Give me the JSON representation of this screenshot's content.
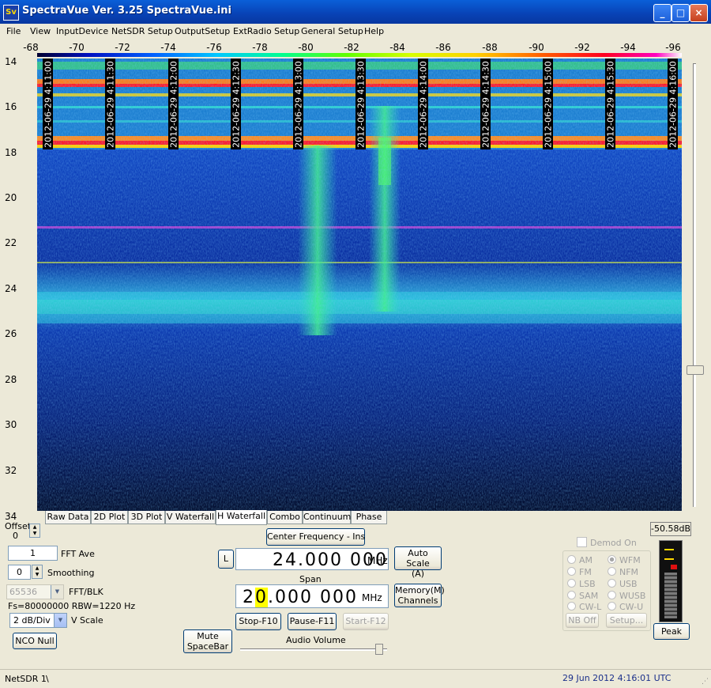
{
  "window": {
    "title": "SpectraVue Ver. 3.25  SpectraVue.ini",
    "icon_text": "Sv",
    "min": "_",
    "max": "□",
    "close": "×"
  },
  "menu": [
    "File",
    "View",
    "InputDevice",
    "NetSDR Setup",
    "OutputSetup",
    "ExtRadio Setup",
    "General Setup",
    "Help"
  ],
  "freq_axis": {
    "labels": [
      "-68",
      "-70",
      "-72",
      "-74",
      "-76",
      "-78",
      "-80",
      "-82",
      "-84",
      "-86",
      "-88",
      "-90",
      "-92",
      "-94",
      "-96"
    ]
  },
  "time_axis": {
    "labels": [
      "14",
      "16",
      "18",
      "20",
      "22",
      "24",
      "26",
      "28",
      "30",
      "32",
      "34"
    ]
  },
  "timestamps": [
    "2012-06-29 4:11:00",
    "2012-06-29 4:11:30",
    "2012-06-29 4:12:00",
    "2012-06-29 4:12:30",
    "2012-06-29 4:13:00",
    "2012-06-29 4:13:30",
    "2012-06-29 4:14:00",
    "2012-06-29 4:14:30",
    "2012-06-29 4:15:00",
    "2012-06-29 4:15:30",
    "2012-06-29 4:16:00"
  ],
  "tabs": [
    {
      "label": "Raw Data"
    },
    {
      "label": "2D Plot"
    },
    {
      "label": "3D Plot"
    },
    {
      "label": "V Waterfall"
    },
    {
      "label": "H Waterfall",
      "active": true
    },
    {
      "label": "Combo"
    },
    {
      "label": "Continuum"
    },
    {
      "label": "Phase"
    }
  ],
  "controls": {
    "offset_label": "Offset",
    "offset_value": "0",
    "fft_ave_value": "1",
    "fft_ave_label": "FFT Ave",
    "smoothing_value": "0",
    "smoothing_label": "Smoothing",
    "fft_blk_value": "65536",
    "fft_blk_label": "FFT/BLK",
    "fs_info": "Fs=80000000 RBW=1220 Hz",
    "vscale_value": "2 dB/Div",
    "vscale_label": "V Scale",
    "nco_null": "NCO Null",
    "mute": "Mute\nSpaceBar",
    "center_freq_button": "Center Frequency - Ins",
    "l_button": "L",
    "center_freq_value": "24.000 000",
    "center_freq_unit": "MHz",
    "span_label": "Span",
    "span_first_digit": "2",
    "span_hl_digit": "0",
    "span_rest": ".000 000",
    "span_unit": "MHz",
    "auto_scale": "Auto Scale\n(A)",
    "memory": "Memory(M)\nChannels",
    "stop": "Stop-F10",
    "pause": "Pause-F11",
    "start": "Start-F12",
    "audio_volume_label": "Audio Volume"
  },
  "demod": {
    "label": "Demod On",
    "modes_left": [
      "AM",
      "FM",
      "LSB",
      "SAM",
      "CW-L"
    ],
    "modes_right": [
      "WFM",
      "NFM",
      "USB",
      "WUSB",
      "CW-U"
    ],
    "selected": "WFM",
    "nb_off": "NB Off",
    "setup": "Setup..."
  },
  "meter": {
    "level_db": "-50.58dB",
    "peak": "Peak",
    "fill_fraction": 0.62
  },
  "status": {
    "left": "NetSDR 1",
    "sep": "\\",
    "right": "29 Jun 2012  4:16:01 UTC"
  },
  "colors": {
    "title_blue": "#0842b5",
    "status_date": "#1a2f8a",
    "waterfall_base": "#0a2a8a",
    "signal_cyan": "#2bd1e0",
    "signal_green": "#40ff70",
    "band_red": "#ff1a2a",
    "band_orange": "#ff8a20"
  }
}
